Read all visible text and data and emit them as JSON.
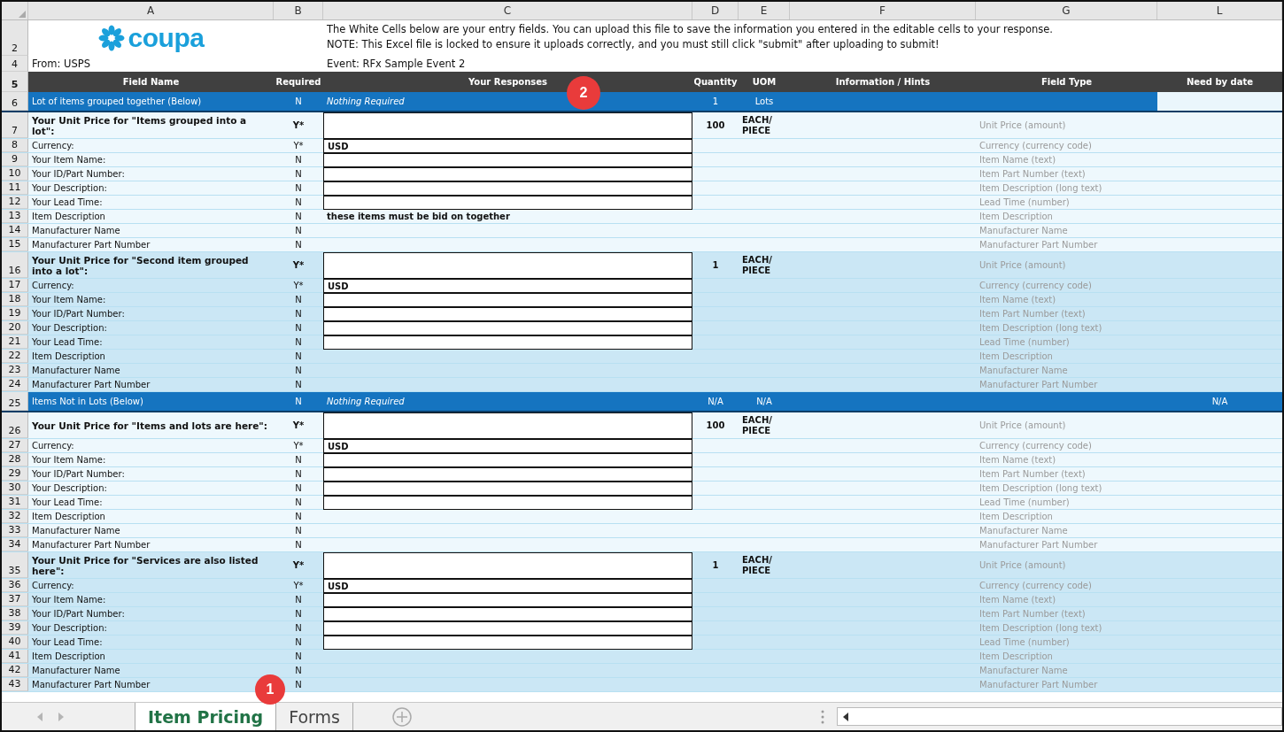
{
  "columns": [
    "A",
    "B",
    "C",
    "D",
    "E",
    "F",
    "G",
    "L"
  ],
  "intro": {
    "row_numbers": [
      "2",
      "4"
    ],
    "logo_text": "coupa",
    "notes": [
      "The White Cells below are your entry fields. You can upload this file to save the information you entered in the editable cells to your response.",
      "NOTE: This Excel file is locked to ensure it uploads correctly, and you must still click \"submit\" after uploading to submit!"
    ],
    "from": "From: USPS",
    "event": "Event: RFx Sample Event 2"
  },
  "table": {
    "header_row": "5",
    "columns": [
      "Field Name",
      "Required",
      "Your Responses",
      "Quantity",
      "UOM",
      "Information / Hints",
      "Field Type",
      "Need by date"
    ],
    "rows": [
      {
        "n": "6",
        "kind": "section",
        "name": "Lot of items grouped together (Below)",
        "required": "N",
        "response": "Nothing Required",
        "quantity": "1",
        "uom": "Lots"
      },
      {
        "n": "7",
        "kind": "price",
        "shaded": false,
        "name": "Your Unit Price for \"Items grouped into a lot\":",
        "required": "Y*",
        "entry": true,
        "quantity": "100",
        "uom": "EACH/ PIECE",
        "field_type": "Unit Price (amount)"
      },
      {
        "n": "8",
        "kind": "field",
        "shaded": false,
        "name": "Currency:",
        "required": "Y*",
        "entry": true,
        "response": "USD",
        "field_type": "Currency (currency code)"
      },
      {
        "n": "9",
        "kind": "field",
        "shaded": false,
        "name": "Your Item Name:",
        "required": "N",
        "entry": true,
        "field_type": "Item Name (text)"
      },
      {
        "n": "10",
        "kind": "field",
        "shaded": false,
        "name": "Your ID/Part Number:",
        "required": "N",
        "entry": true,
        "field_type": "Item Part Number (text)"
      },
      {
        "n": "11",
        "kind": "field",
        "shaded": false,
        "name": "Your Description:",
        "required": "N",
        "entry": true,
        "field_type": "Item Description (long text)"
      },
      {
        "n": "12",
        "kind": "field",
        "shaded": false,
        "name": "Your Lead Time:",
        "required": "N",
        "entry": true,
        "field_type": "Lead Time (number)"
      },
      {
        "n": "13",
        "kind": "field",
        "shaded": false,
        "name": "Item Description",
        "required": "N",
        "entry": false,
        "response": "these items must be bid on together",
        "field_type": "Item Description"
      },
      {
        "n": "14",
        "kind": "field",
        "shaded": false,
        "name": "Manufacturer Name",
        "required": "N",
        "entry": false,
        "field_type": "Manufacturer Name"
      },
      {
        "n": "15",
        "kind": "field",
        "shaded": false,
        "name": "Manufacturer Part Number",
        "required": "N",
        "entry": false,
        "field_type": "Manufacturer Part Number"
      },
      {
        "n": "16",
        "kind": "price",
        "shaded": true,
        "name": "Your Unit Price for \"Second item grouped into a lot\":",
        "required": "Y*",
        "entry": true,
        "quantity": "1",
        "uom": "EACH/ PIECE",
        "field_type": "Unit Price (amount)"
      },
      {
        "n": "17",
        "kind": "field",
        "shaded": true,
        "name": "Currency:",
        "required": "Y*",
        "entry": true,
        "response": "USD",
        "field_type": "Currency (currency code)"
      },
      {
        "n": "18",
        "kind": "field",
        "shaded": true,
        "name": "Your Item Name:",
        "required": "N",
        "entry": true,
        "field_type": "Item Name (text)"
      },
      {
        "n": "19",
        "kind": "field",
        "shaded": true,
        "name": "Your ID/Part Number:",
        "required": "N",
        "entry": true,
        "field_type": "Item Part Number (text)"
      },
      {
        "n": "20",
        "kind": "field",
        "shaded": true,
        "name": "Your Description:",
        "required": "N",
        "entry": true,
        "field_type": "Item Description (long text)"
      },
      {
        "n": "21",
        "kind": "field",
        "shaded": true,
        "name": "Your Lead Time:",
        "required": "N",
        "entry": true,
        "field_type": "Lead Time (number)"
      },
      {
        "n": "22",
        "kind": "field",
        "shaded": true,
        "name": "Item Description",
        "required": "N",
        "entry": false,
        "field_type": "Item Description"
      },
      {
        "n": "23",
        "kind": "field",
        "shaded": true,
        "name": "Manufacturer Name",
        "required": "N",
        "entry": false,
        "field_type": "Manufacturer Name"
      },
      {
        "n": "24",
        "kind": "field",
        "shaded": true,
        "name": "Manufacturer Part Number",
        "required": "N",
        "entry": false,
        "field_type": "Manufacturer Part Number"
      },
      {
        "n": "25",
        "kind": "section",
        "name": "Items Not in Lots (Below)",
        "required": "N",
        "response": "Nothing Required",
        "quantity": "N/A",
        "uom": "N/A",
        "need_by": "N/A"
      },
      {
        "n": "26",
        "kind": "price",
        "shaded": false,
        "name": "Your Unit Price for \"Items and lots are here\":",
        "required": "Y*",
        "entry": true,
        "quantity": "100",
        "uom": "EACH/ PIECE",
        "field_type": "Unit Price (amount)"
      },
      {
        "n": "27",
        "kind": "field",
        "shaded": false,
        "name": "Currency:",
        "required": "Y*",
        "entry": true,
        "response": "USD",
        "field_type": "Currency (currency code)"
      },
      {
        "n": "28",
        "kind": "field",
        "shaded": false,
        "name": "Your Item Name:",
        "required": "N",
        "entry": true,
        "field_type": "Item Name (text)"
      },
      {
        "n": "29",
        "kind": "field",
        "shaded": false,
        "name": "Your ID/Part Number:",
        "required": "N",
        "entry": true,
        "field_type": "Item Part Number (text)"
      },
      {
        "n": "30",
        "kind": "field",
        "shaded": false,
        "name": "Your Description:",
        "required": "N",
        "entry": true,
        "field_type": "Item Description (long text)"
      },
      {
        "n": "31",
        "kind": "field",
        "shaded": false,
        "name": "Your Lead Time:",
        "required": "N",
        "entry": true,
        "field_type": "Lead Time (number)"
      },
      {
        "n": "32",
        "kind": "field",
        "shaded": false,
        "name": "Item Description",
        "required": "N",
        "entry": false,
        "field_type": "Item Description"
      },
      {
        "n": "33",
        "kind": "field",
        "shaded": false,
        "name": "Manufacturer Name",
        "required": "N",
        "entry": false,
        "field_type": "Manufacturer Name"
      },
      {
        "n": "34",
        "kind": "field",
        "shaded": false,
        "name": "Manufacturer Part Number",
        "required": "N",
        "entry": false,
        "field_type": "Manufacturer Part Number"
      },
      {
        "n": "35",
        "kind": "price",
        "shaded": true,
        "name": "Your Unit Price for \"Services are also listed here\":",
        "required": "Y*",
        "entry": true,
        "quantity": "1",
        "uom": "EACH/ PIECE",
        "field_type": "Unit Price (amount)"
      },
      {
        "n": "36",
        "kind": "field",
        "shaded": true,
        "name": "Currency:",
        "required": "Y*",
        "entry": true,
        "response": "USD",
        "field_type": "Currency (currency code)"
      },
      {
        "n": "37",
        "kind": "field",
        "shaded": true,
        "name": "Your Item Name:",
        "required": "N",
        "entry": true,
        "field_type": "Item Name (text)"
      },
      {
        "n": "38",
        "kind": "field",
        "shaded": true,
        "name": "Your ID/Part Number:",
        "required": "N",
        "entry": true,
        "field_type": "Item Part Number (text)"
      },
      {
        "n": "39",
        "kind": "field",
        "shaded": true,
        "name": "Your Description:",
        "required": "N",
        "entry": true,
        "field_type": "Item Description (long text)"
      },
      {
        "n": "40",
        "kind": "field",
        "shaded": true,
        "name": "Your Lead Time:",
        "required": "N",
        "entry": true,
        "field_type": "Lead Time (number)"
      },
      {
        "n": "41",
        "kind": "field",
        "shaded": true,
        "name": "Item Description",
        "required": "N",
        "entry": false,
        "field_type": "Item Description"
      },
      {
        "n": "42",
        "kind": "field",
        "shaded": true,
        "name": "Manufacturer Name",
        "required": "N",
        "entry": false,
        "field_type": "Manufacturer Name"
      },
      {
        "n": "43",
        "kind": "field",
        "shaded": true,
        "name": "Manufacturer Part Number",
        "required": "N",
        "entry": false,
        "field_type": "Manufacturer Part Number"
      }
    ]
  },
  "sheet_tabs": [
    {
      "label": "Item Pricing",
      "selected": true
    },
    {
      "label": "Forms",
      "selected": false
    }
  ],
  "callouts": [
    "1",
    "2"
  ]
}
